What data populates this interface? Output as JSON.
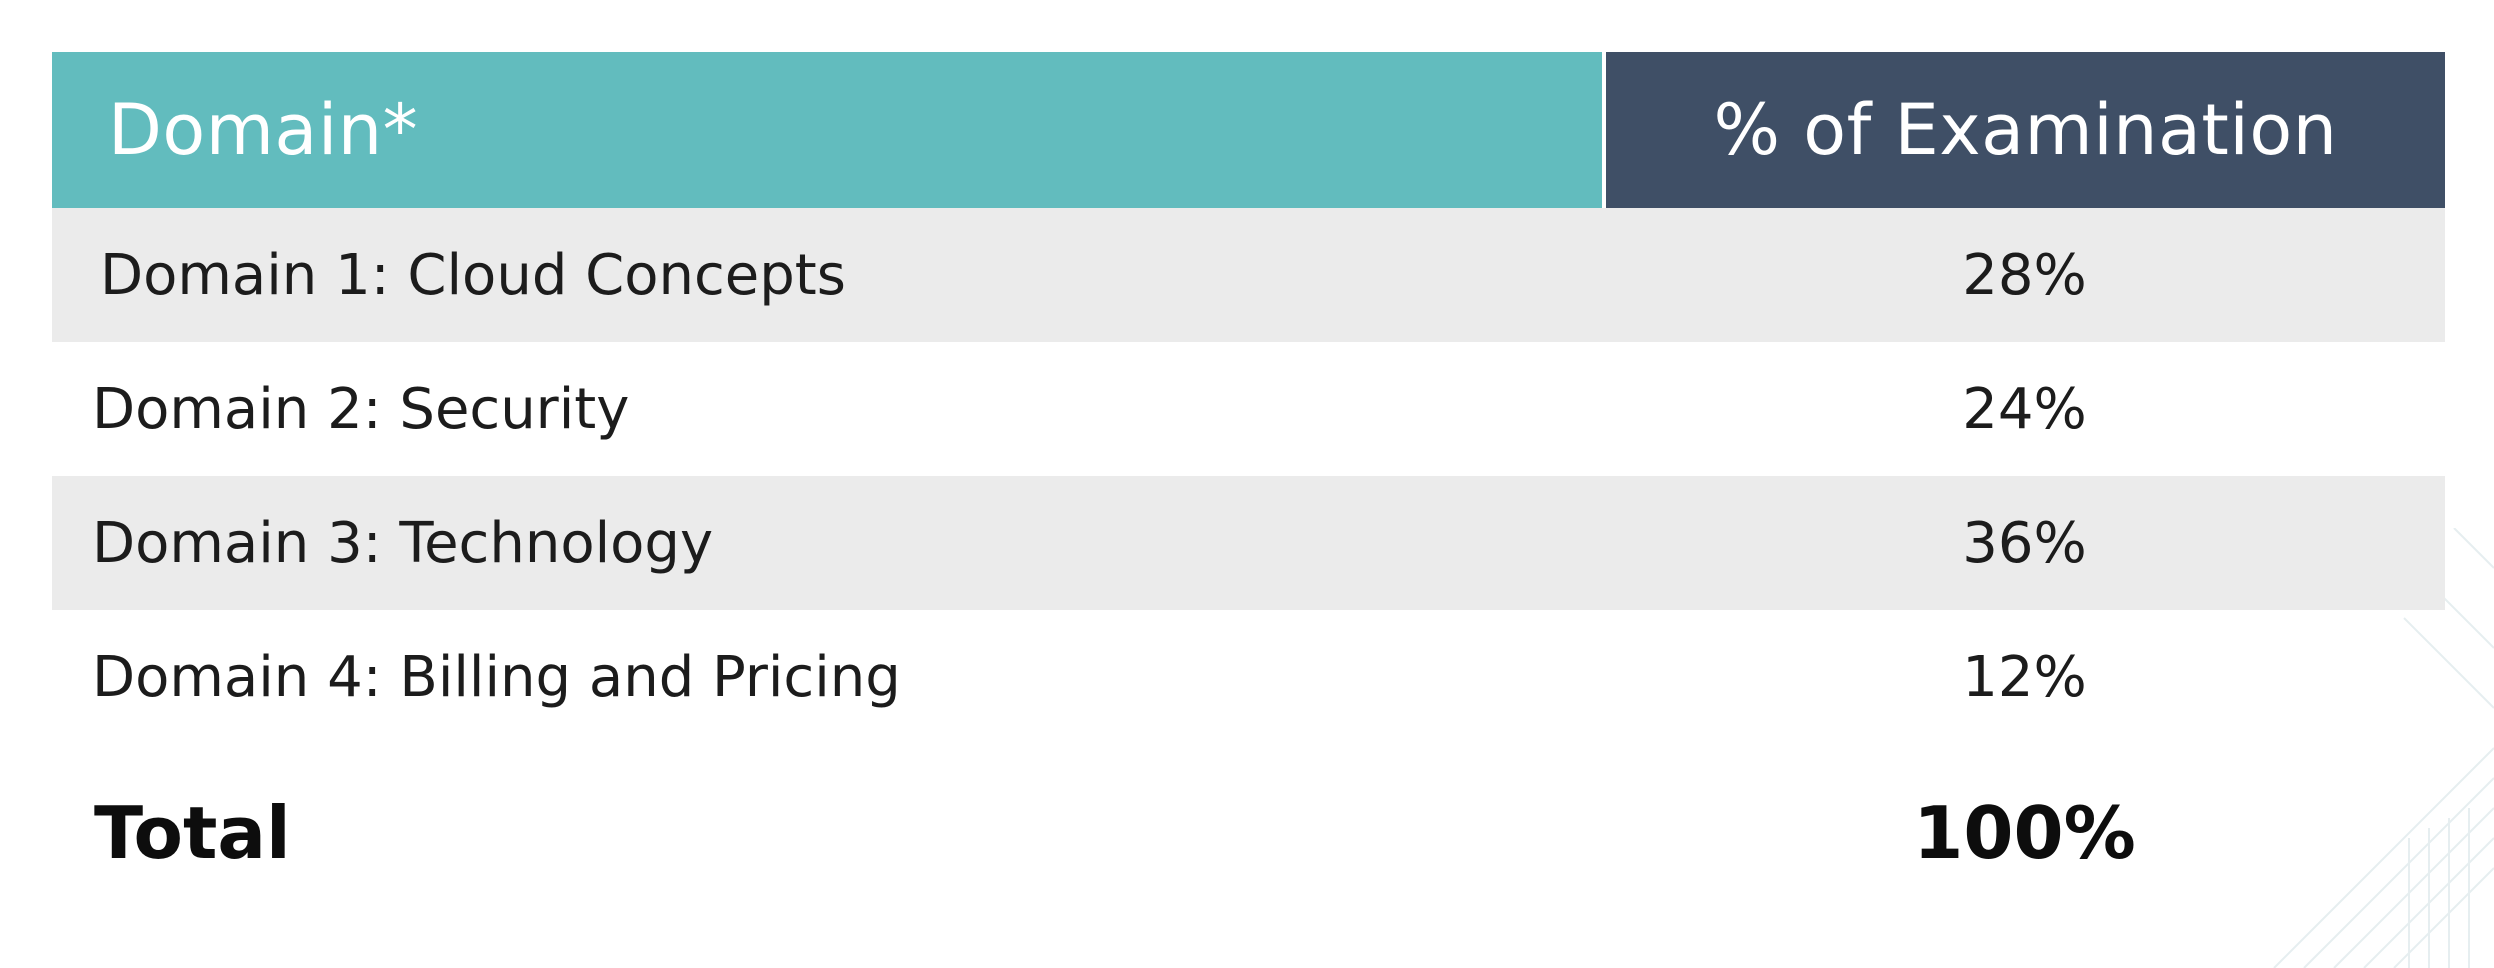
{
  "table": {
    "headers": {
      "domain": "Domain*",
      "percent": "% of Examination"
    },
    "rows": [
      {
        "domain": "Domain 1: Cloud Concepts",
        "percent": "28%"
      },
      {
        "domain": "Domain 2: Security",
        "percent": "24%"
      },
      {
        "domain": "Domain 3: Technology",
        "percent": "36%"
      },
      {
        "domain": "Domain 4: Billing and Pricing",
        "percent": "12%"
      }
    ],
    "total": {
      "label": "Total",
      "percent": "100%"
    }
  },
  "colors": {
    "header_domain_bg": "#62bcbe",
    "header_percent_bg": "#3f4f66",
    "row_shaded_bg": "#ebebeb",
    "text": "#1c1c1c"
  }
}
